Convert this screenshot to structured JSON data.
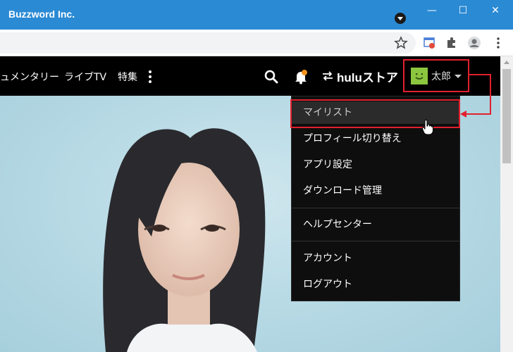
{
  "window": {
    "title": "Buzzword Inc.",
    "controls": [
      "—",
      "☐",
      "✕"
    ]
  },
  "nav": {
    "items": [
      "ュメンタリー",
      "ライブTV",
      "特集"
    ],
    "store_label": "huluストア",
    "user_name": "太郎",
    "notification_color": "#f7931e"
  },
  "menu": {
    "items": [
      "マイリスト",
      "プロフィール切り替え",
      "アプリ設定",
      "ダウンロード管理",
      "ヘルプセンター",
      "アカウント",
      "ログアウト"
    ],
    "highlighted": "マイリスト"
  },
  "colors": {
    "titlebar": "#2a8ad4",
    "annotation_red": "#e2202e",
    "avatar_green": "#8cc63f"
  }
}
